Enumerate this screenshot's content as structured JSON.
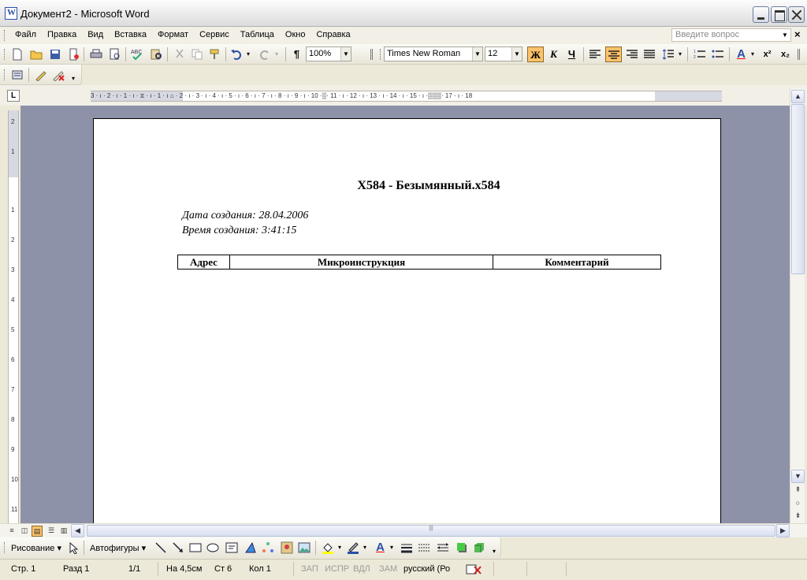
{
  "window": {
    "title": "Документ2 - Microsoft Word"
  },
  "menu": {
    "items": [
      {
        "label": "Файл"
      },
      {
        "label": "Правка"
      },
      {
        "label": "Вид"
      },
      {
        "label": "Вставка"
      },
      {
        "label": "Формат"
      },
      {
        "label": "Сервис"
      },
      {
        "label": "Таблица"
      },
      {
        "label": "Окно"
      },
      {
        "label": "Справка"
      }
    ],
    "help_placeholder": "Введите вопрос"
  },
  "toolbar": {
    "zoom": "100%",
    "font_name": "Times New Roman",
    "font_size": "12",
    "bold_label": "Ж",
    "italic_label": "К",
    "underline_label": "Ч",
    "superscript_label": "x²",
    "subscript_label": "x₂",
    "pilcrow": "¶",
    "highlight_color": "#ffff00",
    "font_color": "#ff0000",
    "accent_active": "#ffc36b"
  },
  "ruler": {
    "h_numbers": "3 · ı · 2 · ı · 1 · ı · ⧖ · ı · 1 · ı ⌂ · 2 · ı · 3 · ı · 4 · ı · 5 · ı · 6 · ı · 7 · ı · 8 · ı · 9 · ı · 10 ·▒· 11 · ı · 12 · ı · 13 · ı · 14 · ı · 15 · ı ·▒▒▒· 17 · ı · 18",
    "v_numbers": [
      "2",
      "1",
      "1",
      "2",
      "3",
      "4",
      "5",
      "6",
      "7",
      "8",
      "9",
      "10",
      "11"
    ]
  },
  "document": {
    "title": "X584 - Безымянный.x584",
    "created_date": "Дата создания: 28.04.2006",
    "created_time": "Время создания: 3:41:15",
    "table_headers": [
      "Адрес",
      "Микроинструкция",
      "Комментарий"
    ]
  },
  "drawing_toolbar": {
    "draw_label": "Рисование ▾",
    "autoshapes_label": "Автофигуры ▾"
  },
  "status": {
    "page": "Стр. 1",
    "section": "Разд 1",
    "page_of": "1/1",
    "at": "На 4,5см",
    "line": "Ст 6",
    "col": "Кол 1",
    "rec": "ЗАП",
    "trk": "ИСПР",
    "ext": "ВДЛ",
    "ovr": "ЗАМ",
    "language": "русский (Ро"
  }
}
